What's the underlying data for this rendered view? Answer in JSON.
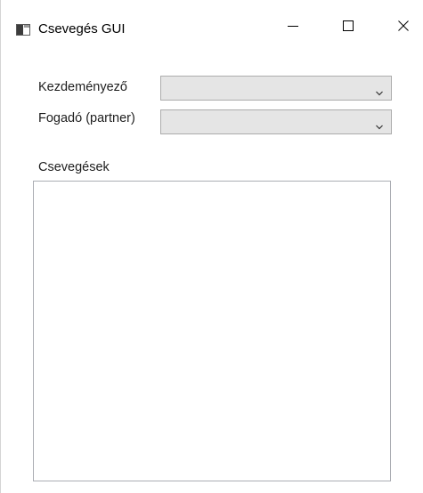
{
  "window": {
    "title": "Csevegés GUI"
  },
  "form": {
    "initiator_label": "Kezdeményező",
    "initiator_value": "",
    "receiver_label": "Fogadó (partner)",
    "receiver_value": "",
    "chats_label": "Csevegések",
    "chats_content": ""
  },
  "icons": {
    "app": "window-app-icon",
    "minimize": "minimize-icon",
    "maximize": "maximize-icon",
    "close": "close-icon",
    "dropdown": "chevron-down-icon"
  }
}
